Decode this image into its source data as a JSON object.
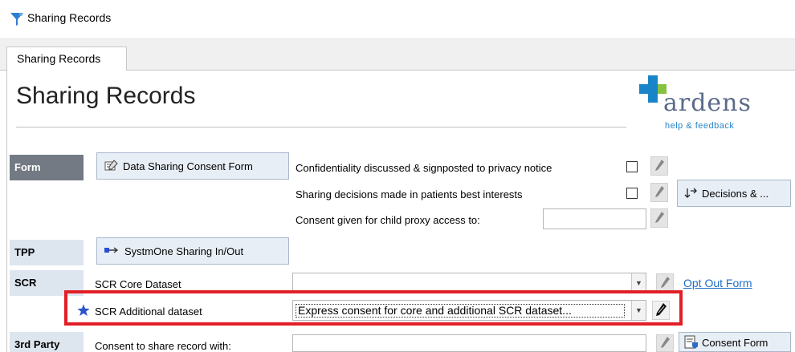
{
  "window": {
    "title": "Sharing Records"
  },
  "tabs": [
    {
      "label": "Sharing Records"
    }
  ],
  "page": {
    "title": "Sharing Records"
  },
  "logo": {
    "name": "ardens",
    "tagline": "help & feedback"
  },
  "sections": {
    "form": {
      "label": "Form",
      "button": "Data Sharing Consent Form",
      "rows": [
        {
          "label": "Confidentiality discussed & signposted to privacy notice",
          "checked": false
        },
        {
          "label": "Sharing decisions made in patients best interests",
          "checked": false
        },
        {
          "label": "Consent given for child proxy access to:",
          "value": ""
        }
      ],
      "decisions_button": "Decisions & ..."
    },
    "tpp": {
      "label": "TPP",
      "button": "SystmOne Sharing In/Out"
    },
    "scr": {
      "label": "SCR",
      "core_label": "SCR Core Dataset",
      "core_value": "",
      "opt_out_link": "Opt Out Form",
      "additional_label": "SCR Additional dataset",
      "additional_value": "Express consent for core and additional SCR dataset..."
    },
    "third_party": {
      "label": "3rd Party",
      "consent_label": "Consent to share record with:",
      "consent_value": "",
      "consent_button": "Consent Form"
    }
  },
  "colors": {
    "highlight": "#e21e26",
    "section_dark": "#737a84",
    "section_light": "#dde5ef",
    "link": "#1f6fc5"
  }
}
